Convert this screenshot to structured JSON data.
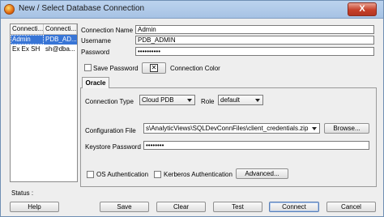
{
  "window": {
    "title": "New / Select Database Connection",
    "close_glyph": "X"
  },
  "connections": {
    "headers": [
      "Connecti...",
      "Connecti..."
    ],
    "rows": [
      [
        "Admin",
        "PDB_AD..."
      ],
      [
        "Ex Ex SH",
        "sh@dba..."
      ]
    ]
  },
  "form": {
    "connection_name_label": "Connection Name",
    "connection_name_value": "Admin",
    "username_label": "Username",
    "username_value": "PDB_ADMIN",
    "password_label": "Password",
    "password_value": "••••••••••",
    "save_password_label": "Save Password",
    "connection_color_label": "Connection Color"
  },
  "tab": {
    "label": "Oracle"
  },
  "oracle": {
    "connection_type_label": "Connection Type",
    "connection_type_value": "Cloud PDB",
    "role_label": "Role",
    "role_value": "default",
    "config_file_label": "Configuration File",
    "config_file_value": "s\\AnalyticViews\\SQLDevConnFiles\\client_credentials.zip",
    "browse_label": "Browse...",
    "keystore_password_label": "Keystore Password",
    "keystore_password_value": "••••••••",
    "os_auth_label": "OS Authentication",
    "kerberos_auth_label": "Kerberos Authentication",
    "advanced_label": "Advanced..."
  },
  "status": {
    "label": "Status :"
  },
  "buttons": {
    "help": "Help",
    "save": "Save",
    "clear": "Clear",
    "test": "Test",
    "connect": "Connect",
    "cancel": "Cancel"
  }
}
